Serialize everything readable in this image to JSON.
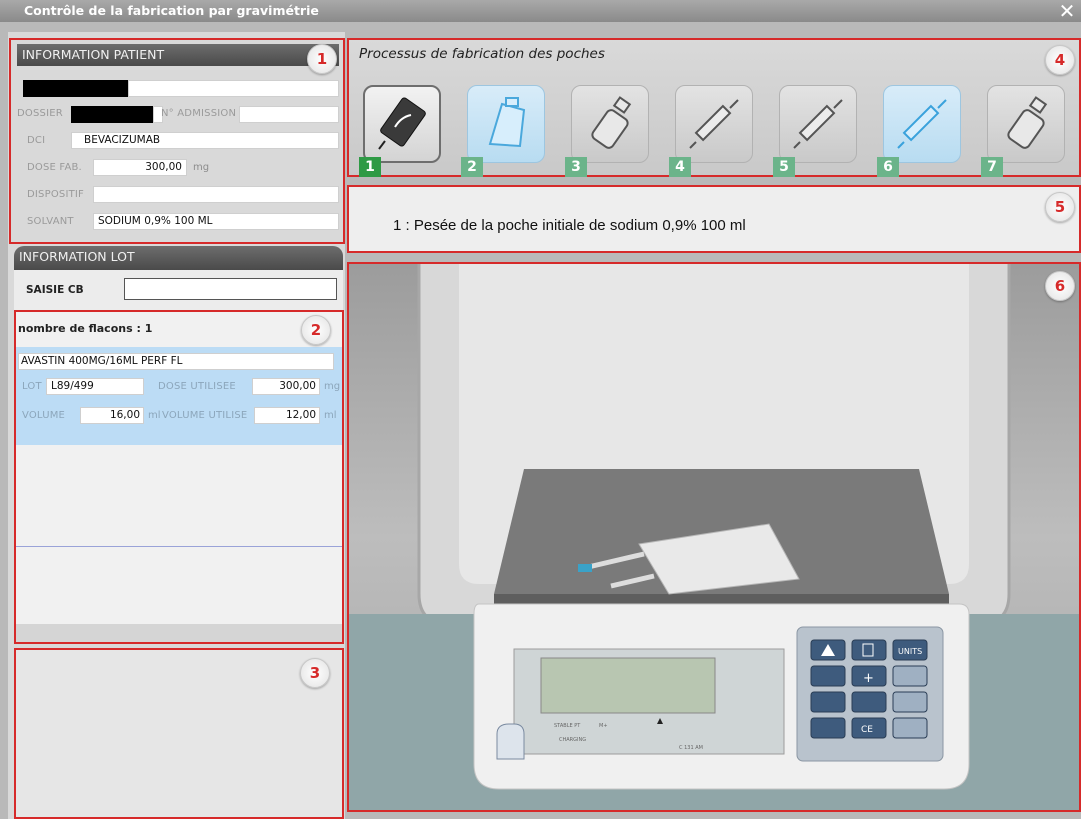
{
  "window": {
    "title": "Contrôle de la fabrication par gravimétrie",
    "close_icon": "close-icon"
  },
  "badges": [
    "1",
    "2",
    "3",
    "4",
    "5",
    "6"
  ],
  "patient": {
    "header": "INFORMATION PATIENT",
    "dossier_label": "DOSSIER",
    "admission_label": "N° ADMISSION",
    "admission_value": "",
    "dci_label": "DCI",
    "dci_value": "BEVACIZUMAB",
    "dose_label": "DOSE FAB.",
    "dose_value": "300,00",
    "dose_unit": "mg",
    "dispositif_label": "DISPOSITIF",
    "dispositif_value": "",
    "solvant_label": "SOLVANT",
    "solvant_value": "SODIUM 0,9% 100 ML"
  },
  "lot": {
    "header": "INFORMATION LOT",
    "saisie_label": "SAISIE CB",
    "saisie_value": "",
    "nb_flacons": "nombre de flacons : 1",
    "item": {
      "name": "AVASTIN 400MG/16ML PERF FL",
      "lot_label": "LOT",
      "lot_value": "L89/499",
      "dose_utilisee_label": "DOSE UTILISEE",
      "dose_utilisee_value": "300,00",
      "dose_unit": "mg",
      "volume_label": "VOLUME",
      "volume_value": "16,00",
      "volume_unit": "ml",
      "volume_utilise_label": "VOLUME UTILISE",
      "volume_utilise_value": "12,00",
      "volume_utilise_unit": "ml"
    }
  },
  "process": {
    "title": "Processus de fabrication des poches",
    "steps": [
      {
        "number": "1",
        "icon": "iv-bag-icon",
        "state": "active"
      },
      {
        "number": "2",
        "icon": "bag-icon",
        "state": "done"
      },
      {
        "number": "3",
        "icon": "vial-icon",
        "state": "pending"
      },
      {
        "number": "4",
        "icon": "syringe-icon",
        "state": "pending"
      },
      {
        "number": "5",
        "icon": "syringe-icon",
        "state": "pending"
      },
      {
        "number": "6",
        "icon": "syringe-icon",
        "state": "done"
      },
      {
        "number": "7",
        "icon": "vial-icon",
        "state": "pending"
      }
    ]
  },
  "instruction": "1 : Pesée de la poche initiale de sodium 0,9% 100 ml",
  "scale": {
    "keys": [
      "UNITS",
      "+",
      "CE"
    ],
    "display_labels": [
      "STABLE PT",
      "M+",
      "CHARGING",
      "C 131 AM"
    ]
  },
  "colors": {
    "accent_red": "#d62a2a",
    "step_green": "#2e9a45",
    "step_green_light": "#6bb48a",
    "selected_blue": "#bcdcf5"
  }
}
